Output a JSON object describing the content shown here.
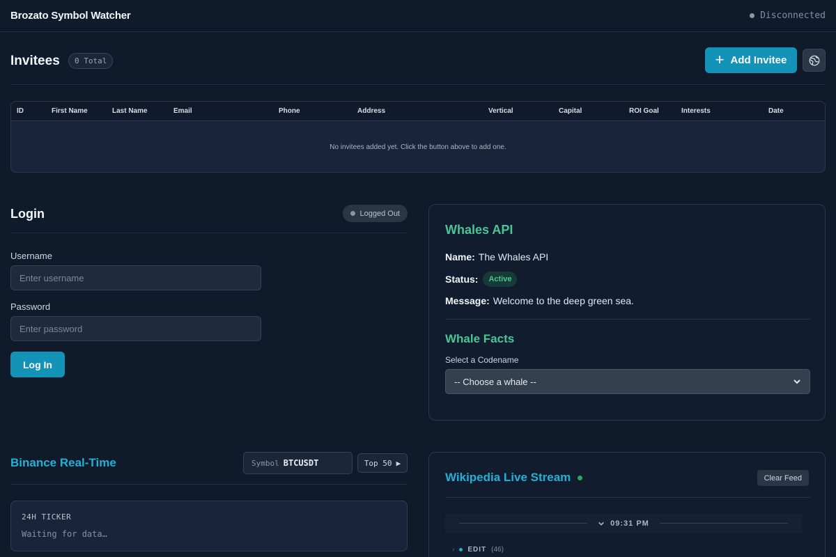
{
  "header": {
    "app_title": "Brozato Symbol Watcher",
    "connection_status": "Disconnected"
  },
  "invitees": {
    "title": "Invitees",
    "total_badge": "0 Total",
    "add_button": "Add Invitee",
    "columns": [
      "ID",
      "First Name",
      "Last Name",
      "Email",
      "Phone",
      "Address",
      "Vertical",
      "Capital",
      "ROI Goal",
      "Interests",
      "Date"
    ],
    "empty_message": "No invitees added yet. Click the button above to add one."
  },
  "login": {
    "title": "Login",
    "status_badge": "Logged Out",
    "username_label": "Username",
    "username_placeholder": "Enter username",
    "password_label": "Password",
    "password_placeholder": "Enter password",
    "submit_label": "Log In"
  },
  "whales": {
    "title": "Whales API",
    "name_label": "Name:",
    "name_value": "The Whales API",
    "status_label": "Status:",
    "status_value": "Active",
    "message_label": "Message:",
    "message_value": "Welcome to the deep green sea.",
    "facts_title": "Whale Facts",
    "select_label": "Select a Codename",
    "select_value": "-- Choose a whale --"
  },
  "binance": {
    "title": "Binance Real-Time",
    "symbol_label": "Symbol",
    "symbol_value": "BTCUSDT",
    "top_button": "Top 50",
    "ticker_label": "24H TICKER",
    "ticker_status": "Waiting for data…"
  },
  "wikipedia": {
    "title": "Wikipedia Live Stream",
    "clear_button": "Clear Feed",
    "time_divider": "09:31 PM",
    "event_type": "EDIT",
    "event_count": "(46)"
  },
  "colors": {
    "accent": "#1493b8",
    "whales_green": "#4cc595",
    "stream_blue": "#22b0d6",
    "background": "#0f1a2b"
  }
}
